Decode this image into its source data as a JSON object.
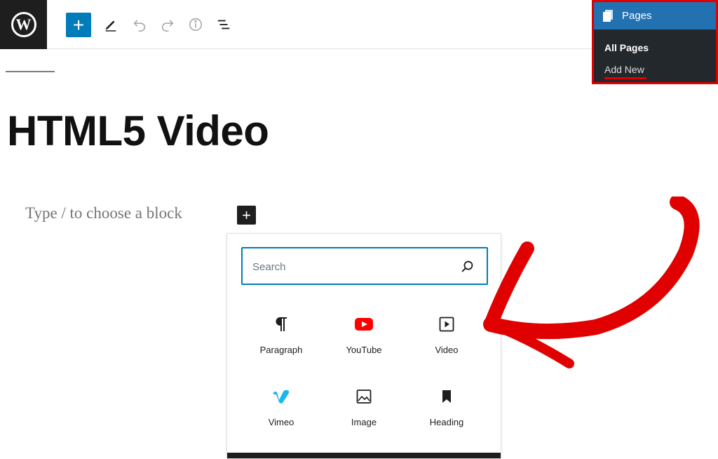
{
  "toolbar": {
    "logo": "wordpress-logo",
    "add_icon": "plus-icon",
    "icons": [
      "pencil-icon",
      "undo-icon",
      "redo-icon",
      "info-icon",
      "list-view-icon"
    ]
  },
  "pages_menu": {
    "title": "Pages",
    "items": [
      "All Pages",
      "Add New"
    ],
    "highlight_color": "#e00000"
  },
  "editor": {
    "title": "HTML5 Video",
    "placeholder": "Type / to choose a block"
  },
  "inserter": {
    "search_placeholder": "Search",
    "blocks": [
      {
        "label": "Paragraph",
        "icon": "paragraph-icon"
      },
      {
        "label": "YouTube",
        "icon": "youtube-icon"
      },
      {
        "label": "Video",
        "icon": "video-icon"
      },
      {
        "label": "Vimeo",
        "icon": "vimeo-icon"
      },
      {
        "label": "Image",
        "icon": "image-icon"
      },
      {
        "label": "Heading",
        "icon": "bookmark-icon"
      }
    ]
  },
  "colors": {
    "accent": "#007cba",
    "annotation": "#e00000",
    "youtube": "#ff0000",
    "vimeo": "#1ab7ea"
  }
}
